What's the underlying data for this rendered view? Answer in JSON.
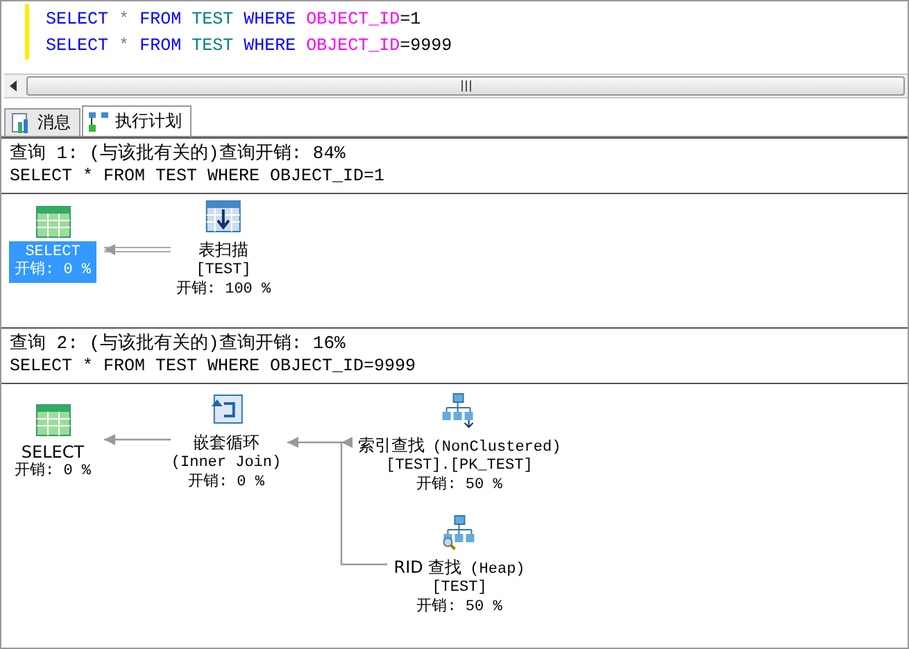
{
  "editor": {
    "lines": [
      {
        "tokens": [
          {
            "text": "SELECT",
            "kind": "keyword"
          },
          {
            "text": "*",
            "kind": "operator"
          },
          {
            "text": "FROM",
            "kind": "keyword"
          },
          {
            "text": "TEST",
            "kind": "table"
          },
          {
            "text": "WHERE",
            "kind": "keyword"
          },
          {
            "text": "OBJECT_ID",
            "kind": "column"
          },
          {
            "text": "=1",
            "kind": "literal"
          }
        ]
      },
      {
        "tokens": [
          {
            "text": "SELECT",
            "kind": "keyword"
          },
          {
            "text": "*",
            "kind": "operator"
          },
          {
            "text": "FROM",
            "kind": "keyword"
          },
          {
            "text": "TEST",
            "kind": "table"
          },
          {
            "text": "WHERE",
            "kind": "keyword"
          },
          {
            "text": "OBJECT_ID",
            "kind": "column"
          },
          {
            "text": "=9999",
            "kind": "literal"
          }
        ]
      }
    ]
  },
  "tabs": [
    {
      "label": "消息",
      "selected": false
    },
    {
      "label": "执行计划",
      "selected": true
    }
  ],
  "queries": [
    {
      "header": "查询 1: (与该批有关的)查询开销: 84%",
      "sql": "SELECT * FROM TEST WHERE OBJECT_ID=1",
      "nodes": [
        {
          "kind": "select",
          "name": "SELECT",
          "cost": "开销: 0 %",
          "selected": true
        },
        {
          "kind": "table_scan",
          "name": "表扫描",
          "object": "[TEST]",
          "cost": "开销: 100 %",
          "selected": false
        }
      ]
    },
    {
      "header": "查询 2: (与该批有关的)查询开销: 16%",
      "sql": "SELECT * FROM TEST WHERE OBJECT_ID=9999",
      "nodes": [
        {
          "kind": "select",
          "name": "SELECT",
          "cost": "开销: 0 %",
          "selected": false
        },
        {
          "kind": "nested_loops",
          "name": "嵌套循环",
          "detail": "(Inner Join)",
          "cost": "开销: 0 %",
          "selected": false
        },
        {
          "kind": "index_seek",
          "name": "索引查找",
          "qualifier": "(NonClustered)",
          "object": "[TEST].[PK_TEST]",
          "cost": "开销: 50 %",
          "selected": false
        },
        {
          "kind": "rid_lookup",
          "name": "RID 查找",
          "qualifier": "(Heap)",
          "object": "[TEST]",
          "cost": "开销: 50 %",
          "selected": false
        }
      ]
    }
  ]
}
